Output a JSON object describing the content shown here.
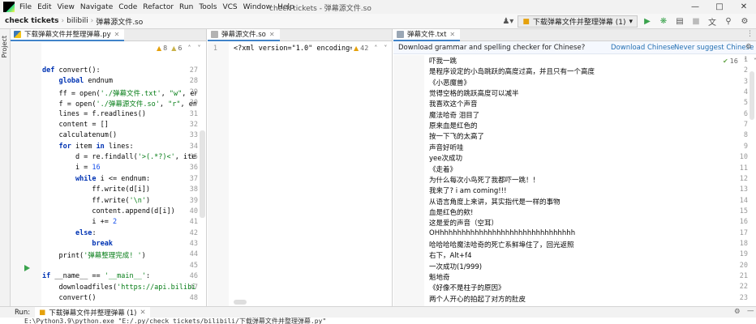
{
  "menubar": {
    "items": [
      "File",
      "Edit",
      "View",
      "Navigate",
      "Code",
      "Refactor",
      "Run",
      "Tools",
      "VCS",
      "Window",
      "Help"
    ],
    "title": "check tickets - 弹幕源文件.so"
  },
  "navbar": {
    "root": "check tickets",
    "folder": "bilibili",
    "file": "弹幕源文件.so",
    "run_config": "下载弹幕文件并整理弹幕 (1)"
  },
  "left_strip": {
    "project_label": "Project"
  },
  "pane1": {
    "tab_label": "下载弹幕文件并整理弹幕.py",
    "warnings": "8",
    "weak_warnings": "6",
    "first_line": 27,
    "lines": [
      "",
      "def convert():",
      "    global endnum",
      "    ff = open('./弹幕文件.txt', \"w\", encodi",
      "    f = open('./弹幕源文件.so', \"r\", encodin",
      "    lines = f.readlines()",
      "    content = []",
      "    calculatenum()",
      "    for item in lines:",
      "        d = re.findall('>(.*?)<', item)",
      "        i = 16",
      "        while i <= endnum:",
      "            ff.write(d[i])",
      "            ff.write('\\n')",
      "            content.append(d[i])",
      "            i += 2",
      "        else:",
      "            break",
      "    print('弹幕整理完成! ')",
      "",
      "if __name__ == '__main__':",
      "    downloadfiles('https://api.bilibili.co",
      "    convert()"
    ],
    "line_numbers": [
      "27",
      "28",
      "29",
      "30",
      "31",
      "32",
      "33",
      "34",
      "35",
      "36",
      "37",
      "38",
      "39",
      "40",
      "41",
      "42",
      "43",
      "44",
      "45",
      "46",
      "47",
      "48"
    ]
  },
  "pane2": {
    "tab_label": "弹幕源文件.so",
    "line_number": "1",
    "line_text": "<?xml version=\"1.0\" encoding='",
    "warnings": "42"
  },
  "pane3": {
    "tab_label": "弹幕文件.txt",
    "notification": "Download grammar and spelling checker for Chinese?",
    "link_download": "Download Chinese",
    "link_never": "Never suggest Chinese",
    "warnings": "16",
    "line_numbers": [
      "1",
      "2",
      "3",
      "4",
      "5",
      "6",
      "7",
      "8",
      "9",
      "10",
      "11",
      "12",
      "13",
      "14",
      "15",
      "16",
      "17",
      "18",
      "19",
      "20",
      "21",
      "22",
      "23"
    ],
    "lines": [
      "吓我一跳",
      "是程序设定的小岛跳跃的高度过高，并且只有一个高度",
      "《小恶魔兽》",
      "觉得空格的跳跃高度可以减半",
      "我喜欢这个声音",
      "魔法哈奇 泪目了",
      "原来血是红色的",
      "按一下飞的太高了",
      "声音好听哇",
      "yee次成功",
      "《走着》",
      "为什么每次小鸟死了我都吓一跳！！",
      "我来了? i am coming!!!",
      "从语言角度上来讲，其实指代是一样的事物",
      "血是红色的欸!",
      "这是爱的声音（空耳）",
      "OHhhhhhhhhhhhhhhhhhhhhhhhhhhhhhhh",
      "哈哈哈哈魔法哈奇的死亡系鲜埠住了，回光返照",
      "右下，Alt+f4",
      "一次成功(1/999)",
      "魁地奇",
      "《好像不是柱子的原因》",
      "两个人开心的拍起了对方的肚皮"
    ]
  },
  "runbar": {
    "label": "Run:",
    "tab": "下载弹幕文件并整理弹幕 (1)",
    "console": "E:\\Python3.9\\python.exe \"E:/.py/check tickets/bilibili/下载弹幕文件并整理弹幕.py\""
  },
  "colors": {
    "accent": "#4083c9",
    "keyword": "#0033b3",
    "string": "#067d17",
    "number": "#1750eb",
    "link": "#2470b3",
    "run_green": "#3aa34d"
  }
}
